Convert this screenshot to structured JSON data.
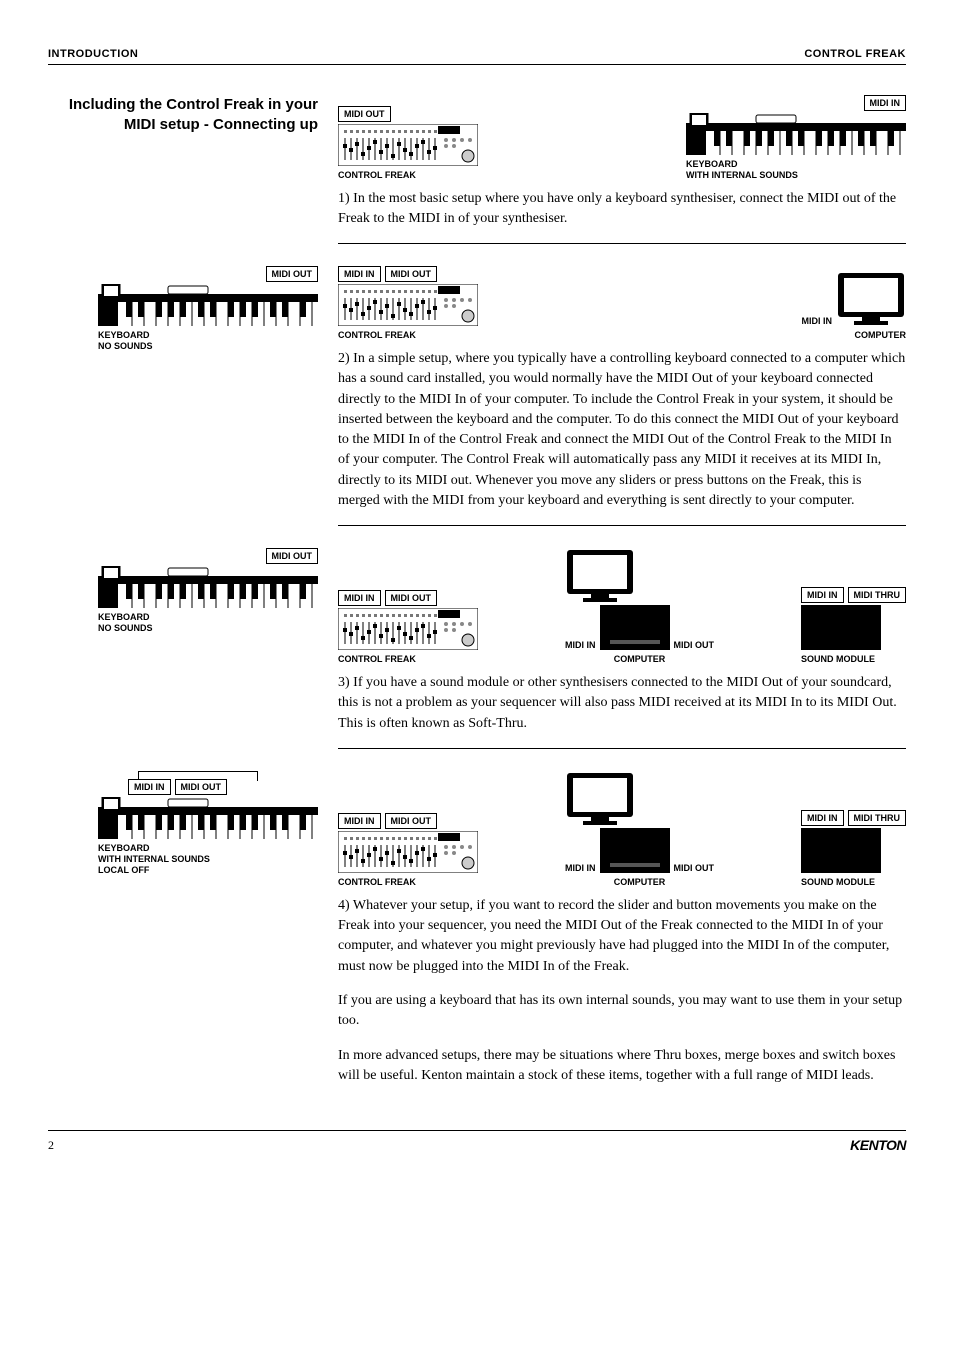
{
  "header": {
    "left": "INTRODUCTION",
    "right": "CONTROL FREAK"
  },
  "title": "Including the Control Freak in your MIDI setup - Connecting up",
  "labels": {
    "midi_out": "MIDI OUT",
    "midi_in": "MIDI IN",
    "midi_thru": "MIDI THRU",
    "control_freak": "CONTROL FREAK",
    "keyboard_internal": "KEYBOARD\nWITH INTERNAL SOUNDS",
    "keyboard_no_sounds": "KEYBOARD\nNO SOUNDS",
    "keyboard_internal_local_off": "KEYBOARD\nWITH INTERNAL SOUNDS\nLOCAL OFF",
    "computer": "COMPUTER",
    "sound_module": "SOUND MODULE"
  },
  "paragraphs": {
    "p1": "1) In the most basic setup where you have only a keyboard synthesiser, connect the MIDI out of the Freak to the MIDI in of your synthesiser.",
    "p2": "2) In a simple setup, where you typically have a controlling keyboard connected to a computer which has a sound card installed, you would normally have the MIDI Out of your keyboard connected directly to the MIDI In of your computer. To include the Control Freak in your system, it should be inserted between the keyboard and the computer. To do this connect the MIDI Out of your keyboard to the MIDI In of the Control Freak and connect the MIDI Out of the Control Freak to the MIDI In of your computer. The Control Freak will automatically pass any MIDI it receives at its MIDI In, directly to its MIDI out. Whenever you move any sliders or press buttons on the Freak, this is merged with the MIDI from your keyboard and everything is sent directly to your computer.",
    "p3": "3) If you have a sound module or other synthesisers connected to the MIDI Out of your soundcard, this is not a problem as your sequencer will also pass MIDI received at its MIDI In to its MIDI Out. This is often known as Soft-Thru.",
    "p4a": "4) Whatever your setup, if you want to record the slider and button movements you make on the Freak into your sequencer, you need the MIDI Out of the Freak connected to the MIDI In of your computer, and whatever you might previously have had plugged into the MIDI In of the computer, must now be plugged into the MIDI In of the Freak.",
    "p4b": "If you are using a keyboard that has its own internal sounds, you may want to use them in your setup too.",
    "p4c": "In more advanced setups, there may be situations where Thru boxes, merge boxes and switch boxes will be useful. Kenton maintain a stock of these items, together with a full range of MIDI leads."
  },
  "footer": {
    "page": "2",
    "brand": "KENTON"
  }
}
